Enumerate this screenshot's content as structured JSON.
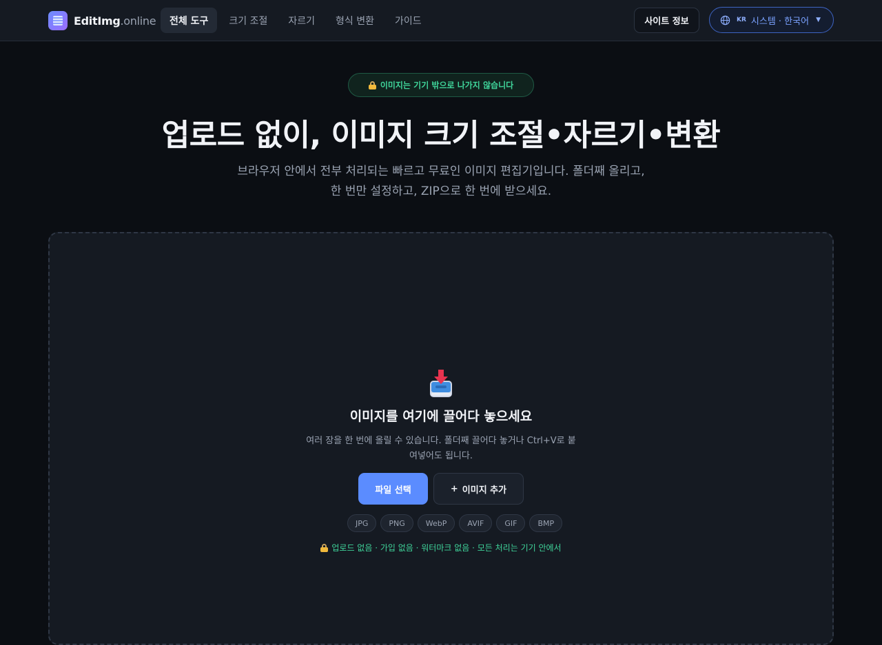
{
  "header": {
    "logo": {
      "name": "EditImg",
      "tld": ".online"
    },
    "nav": [
      {
        "label": "전체 도구",
        "active": true
      },
      {
        "label": "크기 조절",
        "active": false
      },
      {
        "label": "자르기",
        "active": false
      },
      {
        "label": "형식 변환",
        "active": false
      },
      {
        "label": "가이드",
        "active": false
      }
    ],
    "site_info_label": "사이트 정보",
    "language": {
      "icon": "globe-icon",
      "country_code": "KR",
      "label": "시스템 · 한국어",
      "caret_icon": "caret-down-icon"
    }
  },
  "hero": {
    "badge": {
      "icon": "lock-icon",
      "text": "이미지는 기기 밖으로 나가지 않습니다"
    },
    "title": "업로드 없이, 이미지 크기 조절•자르기•변환",
    "subtitle_line1": "브라우저 안에서 전부 처리되는 빠르고 무료인 이미지 편집기입니다. 폴더째 올리고,",
    "subtitle_line2": "한 번만 설정하고, ZIP으로 한 번에 받으세요."
  },
  "dropzone": {
    "icon": "inbox-download-icon",
    "title": "이미지를 여기에 끌어다 놓으세요",
    "description_line1": "여러 장을 한 번에 올릴 수 있습니다. 폴더째 끌어다 놓거나 Ctrl+V로 붙",
    "description_line2": "여넣어도 됩니다.",
    "choose_file_label": "파일 선택",
    "add_image_label": "이미지 추가",
    "add_image_prefix": "+",
    "formats": [
      "JPG",
      "PNG",
      "WebP",
      "AVIF",
      "GIF",
      "BMP"
    ],
    "privacy_note": "업로드 없음 · 가입 없음 · 워터마크 없음 · 모든 처리는 기기 안에서"
  },
  "colors": {
    "background": "#0b0e13",
    "surface": "#151a22",
    "accent": "#5b8cff",
    "success": "#3fd49a"
  }
}
